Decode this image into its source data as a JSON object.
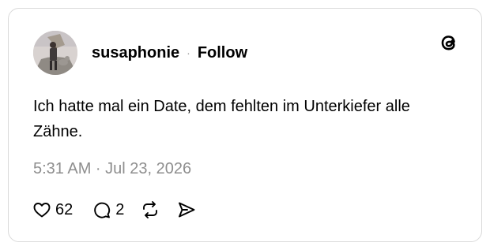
{
  "post": {
    "username": "susaphonie",
    "separator": "·",
    "follow_label": "Follow",
    "text": "Ich hatte mal ein Date, dem fehlten im Unterkiefer alle Zähne.",
    "timestamp": "5:31 AM · Jul 23, 2026",
    "likes": "62",
    "replies": "2"
  },
  "icons": {
    "brand": "threads-logo-icon",
    "like": "heart-icon",
    "reply": "comment-icon",
    "repost": "repost-icon",
    "share": "send-icon"
  },
  "colors": {
    "text": "#000000",
    "muted": "#8e8e8e",
    "border": "#d9d9d9"
  }
}
